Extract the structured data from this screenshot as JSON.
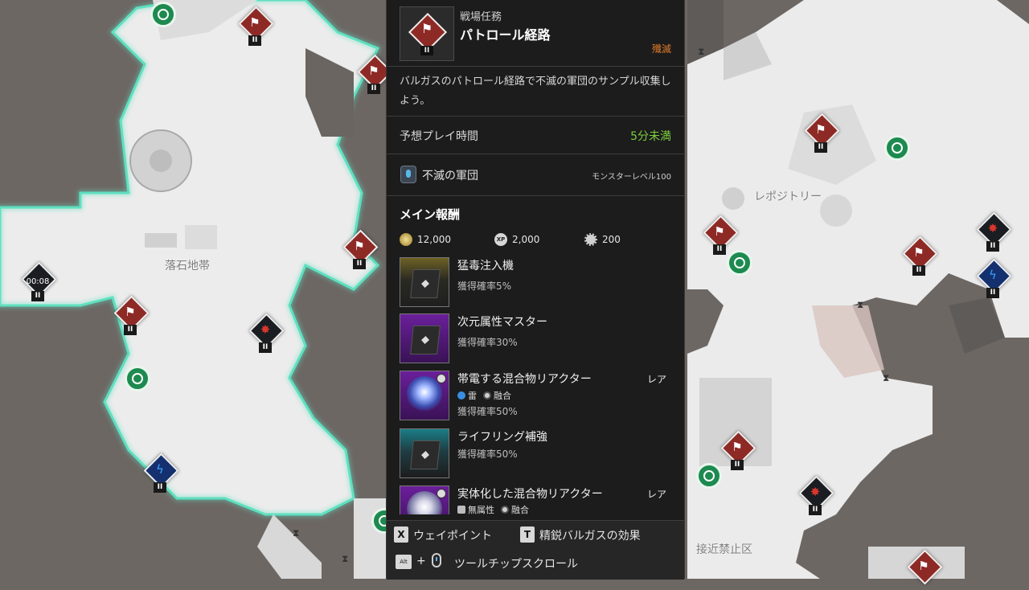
{
  "map": {
    "labels": [
      "落石地帯",
      "レポジトリー",
      "接近禁止区"
    ],
    "timer": "00:08",
    "tier_mark": "II"
  },
  "mission": {
    "category": "戦場任務",
    "title": "パトロール経路",
    "tag": "殲滅",
    "tier": "II",
    "description": "バルガスのパトロール経路で不滅の軍団のサンプル収集しよう。",
    "play_time_label": "予想プレイ時間",
    "play_time_value": "5分未満",
    "faction": "不滅の軍団",
    "monster_level": "モンスターレベル100"
  },
  "rewards": {
    "section_title": "メイン報酬",
    "currency": [
      {
        "icon": "gold-coin-icon",
        "value": "12,000"
      },
      {
        "icon": "xp-icon",
        "value": "2,000"
      },
      {
        "icon": "gear-icon",
        "value": "200"
      }
    ],
    "items": [
      {
        "name": "猛毒注入機",
        "chance": "獲得確率5%",
        "rarity": "",
        "color": "gold",
        "attrs": []
      },
      {
        "name": "次元属性マスター",
        "chance": "獲得確率30%",
        "rarity": "",
        "color": "purple",
        "attrs": []
      },
      {
        "name": "帯電する混合物リアクター",
        "chance": "獲得確率50%",
        "rarity": "レア",
        "color": "purple",
        "attrs": [
          "雷",
          "融合"
        ]
      },
      {
        "name": "ライフリング補強",
        "chance": "獲得確率50%",
        "rarity": "",
        "color": "cyan",
        "attrs": []
      },
      {
        "name": "実体化した混合物リアクター",
        "chance": "",
        "rarity": "レア",
        "color": "purple",
        "attrs": [
          "無属性",
          "融合"
        ]
      }
    ]
  },
  "footer": {
    "waypoint_key": "X",
    "waypoint_label": "ウェイポイント",
    "elite_key": "T",
    "elite_label": "精鋭バルガスの効果",
    "alt_key": "Alt",
    "plus": "+",
    "scroll_label": "ツールチップスクロール"
  },
  "colors": {
    "accent_green": "#7cce3e",
    "tag_orange": "#e07b2a",
    "marker_red": "#8e2a25",
    "zone_outline": "#5fe0c0"
  }
}
